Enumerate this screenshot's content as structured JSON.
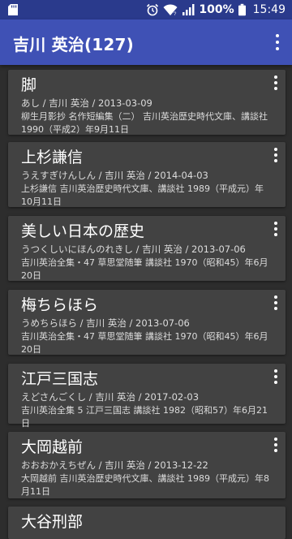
{
  "status_bar": {
    "battery_percent": "100%",
    "time": "15:49",
    "icons": [
      "sd-card-icon",
      "alarm-icon",
      "wifi-icon",
      "signal-icon",
      "battery-icon"
    ]
  },
  "app_bar": {
    "title": "吉川 英治(127)",
    "menu_icon": "more-vertical-icon"
  },
  "colors": {
    "status_bar": "#2a3a8c",
    "app_bar": "#3f51b5",
    "background": "#2d2d2d",
    "card": "#424242"
  },
  "works": [
    {
      "title": "脚",
      "meta": "あし / 吉川 英治 / 2013-03-09",
      "desc": "柳生月影抄 名作短編集（二） 吉川英治歴史時代文庫、講談社 1990（平成2）年9月11日"
    },
    {
      "title": "上杉謙信",
      "meta": "うえすぎけんしん / 吉川 英治 / 2014-04-03",
      "desc": "上杉謙信 吉川英治歴史時代文庫、講談社 1989（平成元）年10月11日"
    },
    {
      "title": "美しい日本の歴史",
      "meta": "うつくしいにほんのれきし / 吉川 英治 / 2013-07-06",
      "desc": "吉川英治全集・47 草思堂随筆 講談社 1970（昭和45）年6月20日"
    },
    {
      "title": "梅ちらほら",
      "meta": "うめちらほら / 吉川 英治 / 2013-07-06",
      "desc": "吉川英治全集・47 草思堂随筆 講談社 1970（昭和45）年6月20日"
    },
    {
      "title": "江戸三国志",
      "meta": "えどさんごくし / 吉川 英治 / 2017-02-03",
      "desc": "吉川英治全集 5 江戸三国志 講談社 1982（昭和57）年6月21日"
    },
    {
      "title": "大岡越前",
      "meta": "おおおかえちぜん / 吉川 英治 / 2013-12-22",
      "desc": "大岡越前 吉川英治歴史時代文庫、講談社 1989（平成元）年8月11日"
    },
    {
      "title": "大谷刑部",
      "meta": "",
      "desc": ""
    }
  ]
}
